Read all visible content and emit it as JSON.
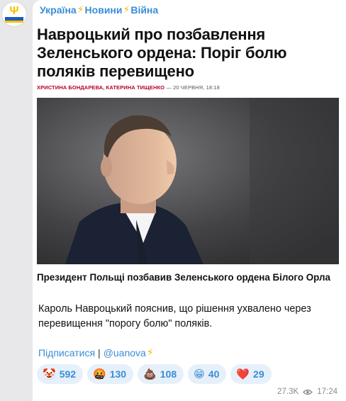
{
  "channel": {
    "name_parts": [
      "Україна",
      "Новини",
      "Війна"
    ]
  },
  "article": {
    "title": "Навроцький про позбавлення Зеленського ордена: Поріг болю поляків перевищено",
    "authors": "ХРИСТИНА БОНДАРЕВА, КАТЕРИНА ТИЩЕНКО",
    "date": "— 20 ЧЕРВНЯ, 18:18"
  },
  "post": {
    "caption": "Президент Польщі позбавив Зеленського ордена Білого Орла",
    "description": "Кароль Навроцький пояснив, що рішення ухвалено через перевищення \"порогу болю\" поляків.",
    "subscribe_label": "Підписатися",
    "separator": "|",
    "handle": "@uanova"
  },
  "reactions": [
    {
      "emoji": "🤡",
      "count": "592"
    },
    {
      "emoji": "🤬",
      "count": "130"
    },
    {
      "emoji": "💩",
      "count": "108"
    },
    {
      "emoji": "😁",
      "count": "40"
    },
    {
      "emoji": "❤️",
      "count": "29"
    }
  ],
  "meta": {
    "views": "27.3K",
    "time": "17:24"
  },
  "colors": {
    "link": "#3a8dd6",
    "accent_byline": "#b5002b",
    "bolt": "#f5b400"
  }
}
